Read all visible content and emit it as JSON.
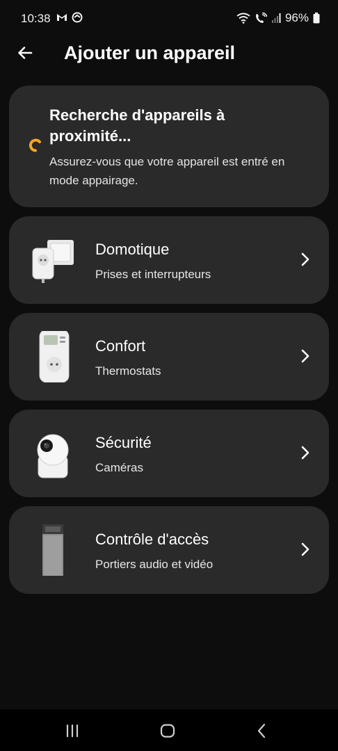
{
  "status_bar": {
    "time": "10:38",
    "battery_percent": "96%",
    "left_icons": [
      "gmail-icon",
      "sync-icon"
    ],
    "right_icons": [
      "wifi-icon",
      "wifi-calling-icon",
      "signal-icon",
      "battery-icon"
    ]
  },
  "header": {
    "back_icon": "arrow-left-icon",
    "title": "Ajouter un appareil"
  },
  "scan": {
    "title": "Recherche d'appareils à proximité...",
    "subtitle": "Assurez-vous que votre appareil est entré en mode appairage.",
    "spinner_color": "#f5a623"
  },
  "categories": [
    {
      "title": "Domotique",
      "subtitle": "Prises et interrupteurs",
      "image": "smart-plug-switch-image"
    },
    {
      "title": "Confort",
      "subtitle": "Thermostats",
      "image": "thermostat-image"
    },
    {
      "title": "Sécurité",
      "subtitle": "Caméras",
      "image": "camera-image"
    },
    {
      "title": "Contrôle d'accès",
      "subtitle": "Portiers audio et vidéo",
      "image": "door-intercom-image"
    }
  ],
  "colors": {
    "background": "#0d0d0d",
    "card": "#2a2a2a",
    "accent": "#f5a623",
    "text": "#ffffff"
  },
  "nav_bar": {
    "buttons": [
      "recents-icon",
      "home-icon",
      "back-nav-icon"
    ]
  }
}
